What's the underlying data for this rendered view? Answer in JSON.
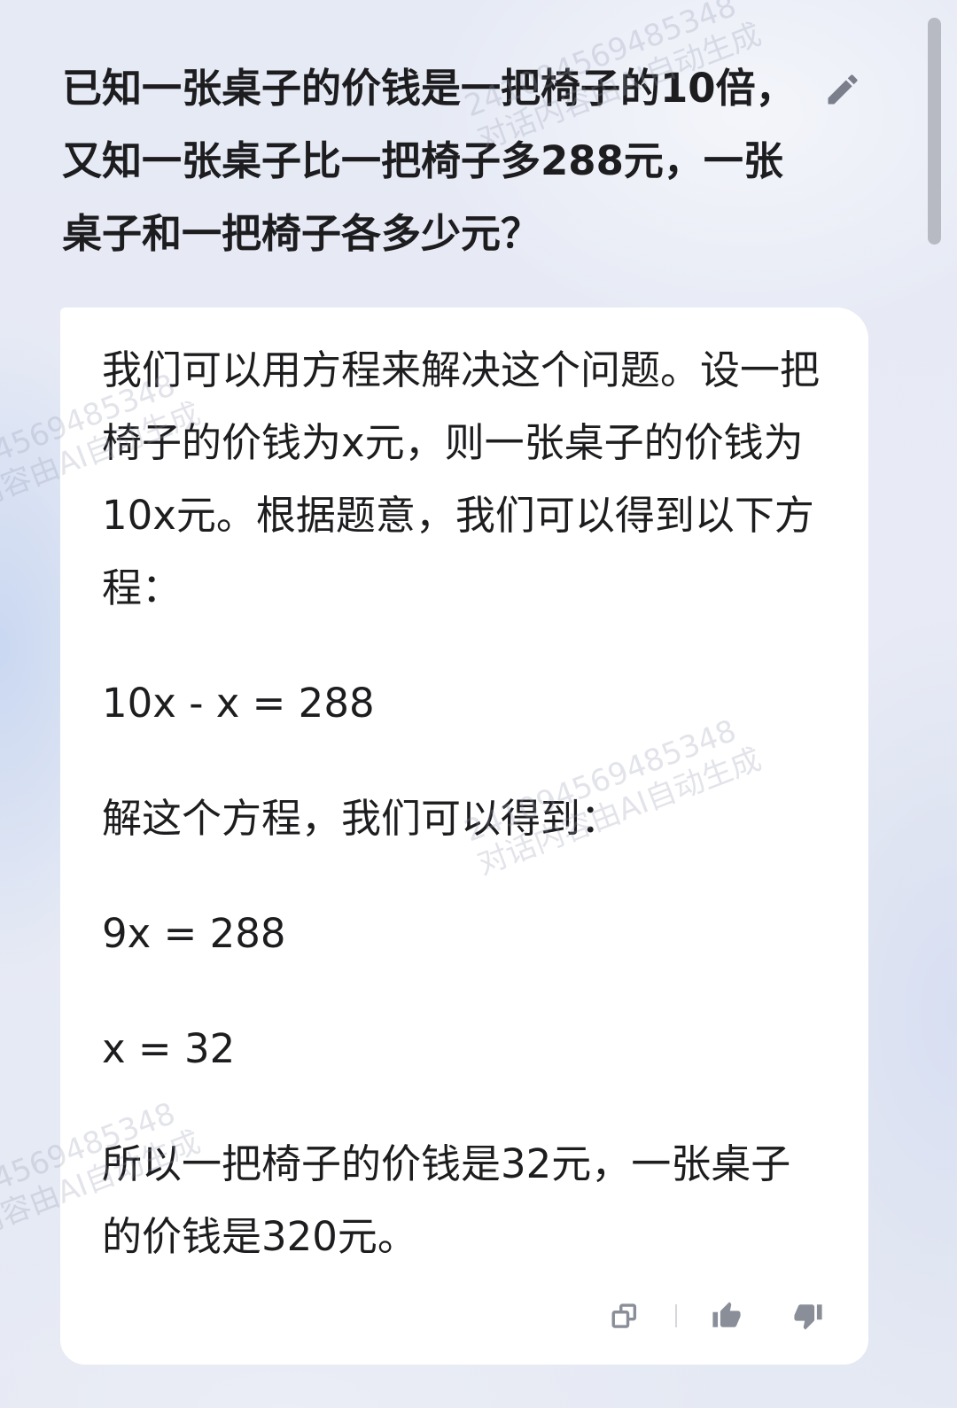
{
  "question": {
    "lines": [
      "已知一张桌子的价钱是一把椅子的10倍，",
      "又知一张桌子比一把椅子多288元，一张",
      "桌子和一把椅子各多少元？"
    ]
  },
  "answer": {
    "paragraphs": [
      {
        "lines": [
          "我们可以用方程来解决这个问题。设一把",
          "椅子的价钱为x元，则一张桌子的价钱为",
          "10x元。根据题意，我们可以得到以下方",
          "程："
        ]
      },
      {
        "lines": [
          "10x - x = 288"
        ]
      },
      {
        "lines": [
          "解这个方程，我们可以得到："
        ]
      },
      {
        "lines": [
          "9x = 288"
        ]
      },
      {
        "lines": [
          "x = 32"
        ]
      },
      {
        "lines": [
          "所以一把椅子的价钱是32元，一张桌子",
          "的价钱是320元。"
        ]
      }
    ]
  },
  "icons": {
    "edit": "pencil-icon",
    "copy": "copy-icon",
    "like": "thumbs-up-icon",
    "dislike": "thumbs-down-icon"
  },
  "watermark": {
    "code": "241094569485348",
    "notice": "对话内容由AI自动生成"
  },
  "colors": {
    "text": "#1d1d1f",
    "icon": "#8a8e98",
    "edit": "#7b7f8b",
    "card": "#ffffff",
    "scroll": "#b7bac2",
    "divider": "#d5d7dc",
    "wm": "rgba(150,158,178,0.28)"
  }
}
